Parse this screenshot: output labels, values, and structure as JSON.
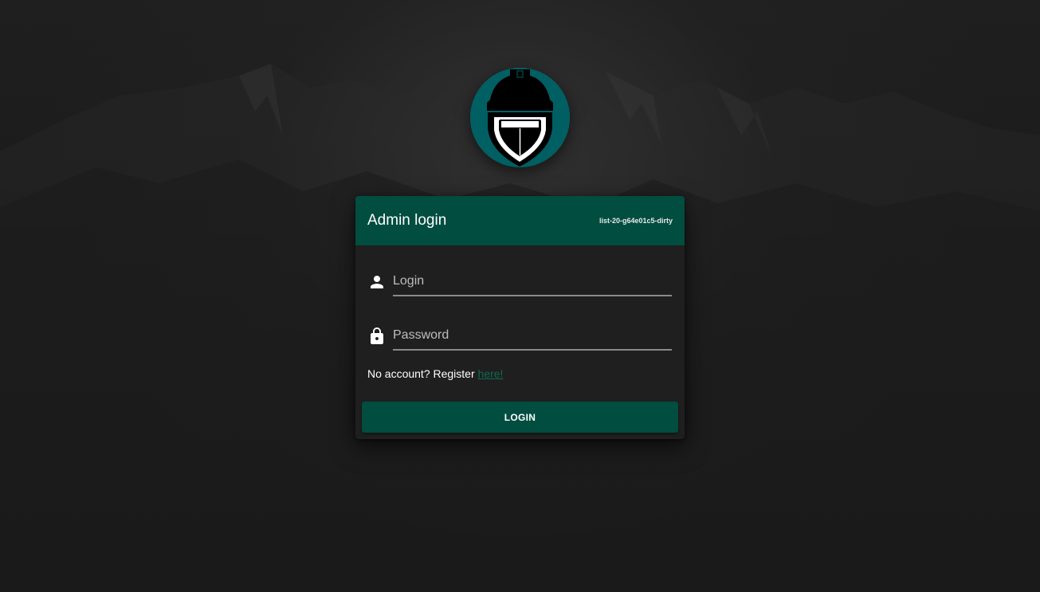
{
  "colors": {
    "header_bg": "#014d40",
    "button_bg": "#014d40",
    "card_bg": "#1f1f1f",
    "logo_circle": "#005f63",
    "link": "#0d6b52"
  },
  "logo": {
    "icon": "helmet-shield-logo"
  },
  "card": {
    "title": "Admin login",
    "version": "list-20-g64e01c5-dirty"
  },
  "form": {
    "login": {
      "icon": "person-icon",
      "placeholder": "Login",
      "value": ""
    },
    "password": {
      "icon": "lock-icon",
      "placeholder": "Password",
      "value": ""
    },
    "register_text": "No account? Register ",
    "register_link": "here!",
    "submit_label": "LOGIN"
  }
}
